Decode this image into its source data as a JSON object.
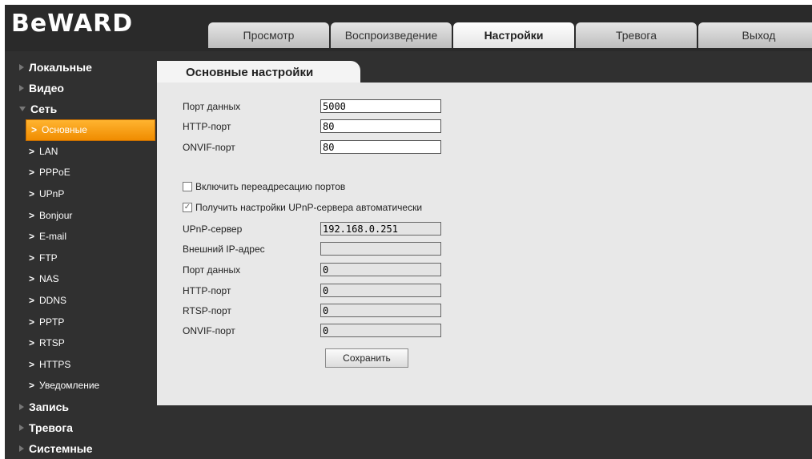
{
  "brand": {
    "logo_text": "BeWARD"
  },
  "nav": {
    "tabs": [
      {
        "label": "Просмотр",
        "active": false
      },
      {
        "label": "Воспроизведение",
        "active": false
      },
      {
        "label": "Настройки",
        "active": true
      },
      {
        "label": "Тревога",
        "active": false
      },
      {
        "label": "Выход",
        "active": false
      }
    ]
  },
  "sidebar": {
    "categories": {
      "local": "Локальные",
      "video": "Видео",
      "network": "Сеть",
      "record": "Запись",
      "alarm": "Тревога",
      "system": "Системные"
    },
    "network_items": [
      {
        "label": "Основные",
        "active": true
      },
      {
        "label": "LAN"
      },
      {
        "label": "PPPoE"
      },
      {
        "label": "UPnP"
      },
      {
        "label": "Bonjour"
      },
      {
        "label": "E-mail"
      },
      {
        "label": "FTP"
      },
      {
        "label": "NAS"
      },
      {
        "label": "DDNS"
      },
      {
        "label": "PPTP"
      },
      {
        "label": "RTSP"
      },
      {
        "label": "HTTPS"
      },
      {
        "label": "Уведомление"
      }
    ]
  },
  "main": {
    "section_title": "Основные настройки",
    "fields": {
      "data_port": {
        "label": "Порт данных",
        "value": "5000"
      },
      "http_port": {
        "label": "HTTP-порт",
        "value": "80"
      },
      "onvif_port": {
        "label": "ONVIF-порт",
        "value": "80"
      }
    },
    "port_forward": {
      "label": "Включить переадресацию портов",
      "checked": false
    },
    "upnp_auto": {
      "label": "Получить настройки UPnP-сервера автоматически",
      "checked": true
    },
    "upnp_fields": {
      "server": {
        "label": "UPnP-сервер",
        "value": "192.168.0.251"
      },
      "external_ip": {
        "label": "Внешний IP-адрес",
        "value": ""
      },
      "data_port": {
        "label": "Порт данных",
        "value": "0"
      },
      "http_port": {
        "label": "HTTP-порт",
        "value": "0"
      },
      "rtsp_port": {
        "label": "RTSP-порт",
        "value": "0"
      },
      "onvif_port": {
        "label": "ONVIF-порт",
        "value": "0"
      }
    },
    "save_label": "Сохранить"
  },
  "colors": {
    "accent_active": "#f39c12",
    "background_dark": "#303030",
    "panel_light": "#e8e8e8"
  }
}
